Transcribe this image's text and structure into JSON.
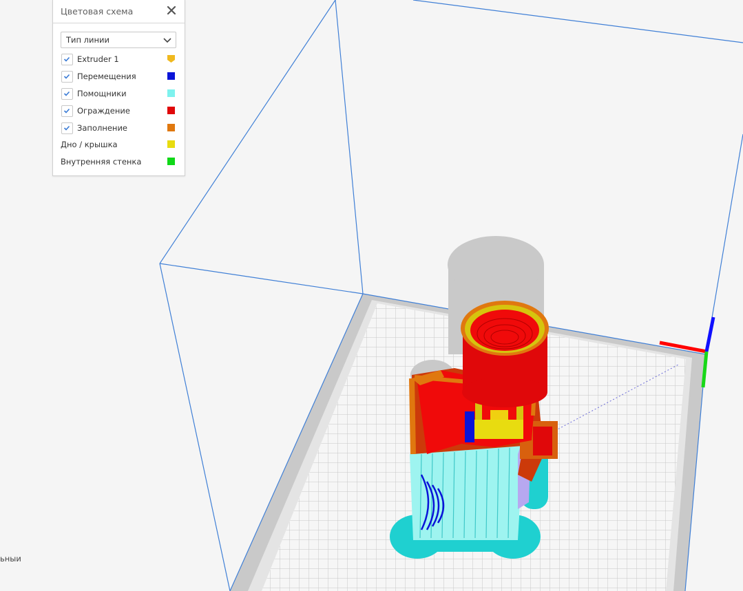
{
  "panel": {
    "title": "Цветовая схема",
    "close_icon": "close-icon",
    "line_type_select": {
      "value": "Тип линии",
      "icon": "chevron-down-icon"
    },
    "legend": [
      {
        "label": "Extruder 1",
        "checked": true,
        "color": "#f0b91f",
        "swatch_shape": "shield"
      },
      {
        "label": "Перемещения",
        "checked": true,
        "color": "#0a14d8"
      },
      {
        "label": "Помощники",
        "checked": true,
        "color": "#7ef2ee"
      },
      {
        "label": "Ограждение",
        "checked": true,
        "color": "#e0080a"
      },
      {
        "label": "Заполнение",
        "checked": true,
        "color": "#e0780f"
      },
      {
        "label": "Дно / крышка",
        "checked": null,
        "color": "#e8dc10"
      },
      {
        "label": "Внутренняя стенка",
        "checked": null,
        "color": "#10d818"
      }
    ]
  },
  "side_label": "ьныи",
  "axis_colors": {
    "x": "#ff0000",
    "y": "#18d818",
    "z": "#1010ff"
  },
  "build_volume_color": "#3f7fd6"
}
